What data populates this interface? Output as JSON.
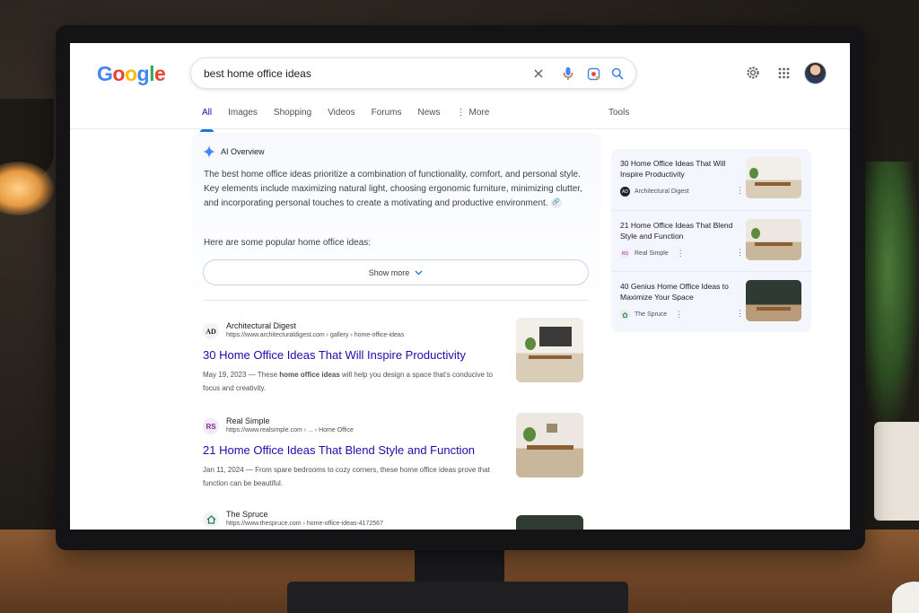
{
  "search": {
    "query": "best home office ideas"
  },
  "tabs": [
    {
      "label": "All"
    },
    {
      "label": "Images"
    },
    {
      "label": "Shopping"
    },
    {
      "label": "Videos"
    },
    {
      "label": "Forums"
    },
    {
      "label": "News"
    },
    {
      "label": "More"
    }
  ],
  "tools_label": "Tools",
  "ai_overview": {
    "heading": "AI Overview",
    "body": "The best home office ideas prioritize a combination of functionality, comfort, and personal style. Key elements include maximizing natural light, choosing ergonomic furniture, minimizing clutter, and incorporating personal touches to create a motivating and productive environment.",
    "subheading": "Here are some popular home office ideas:",
    "show_more": "Show more"
  },
  "results": [
    {
      "favicon": "AD",
      "site": "Architectural Digest",
      "url": "https://www.architecturaldigest.com › gallery › home-office-ideas",
      "title": "30 Home Office Ideas That Will Inspire Productivity",
      "snippet_date": "May 19, 2023 — These ",
      "snippet_bold": "home office ideas",
      "snippet_rest": " will help you design a space that's conducive to focus and creativity."
    },
    {
      "favicon": "RS",
      "site": "Real Simple",
      "url": "https://www.realsimple.com › ... › Home Office",
      "title": "21 Home Office Ideas That Blend Style and Function",
      "snippet": "Jan 11, 2024 — From spare bedrooms to cozy corners, these home office ideas prove that function can be beautiful."
    },
    {
      "favicon": "house",
      "site": "The Spruce",
      "url": "https://www.thespruce.com › home-office-ideas-4172567"
    }
  ],
  "side_cards": [
    {
      "title": "30 Home Office Ideas That Will Inspire Productivity",
      "source": "Architectural Digest",
      "favicon": "AD"
    },
    {
      "title": "21 Home Office Ideas That Blend Style and Function",
      "source": "Real Simple",
      "favicon": "RS"
    },
    {
      "title": "40 Genius Home Office Ideas to Maximize Your Space",
      "source": "The Spruce",
      "favicon": "house"
    }
  ],
  "colors": {
    "link": "#1a0dab",
    "accent": "#1a73e8"
  }
}
